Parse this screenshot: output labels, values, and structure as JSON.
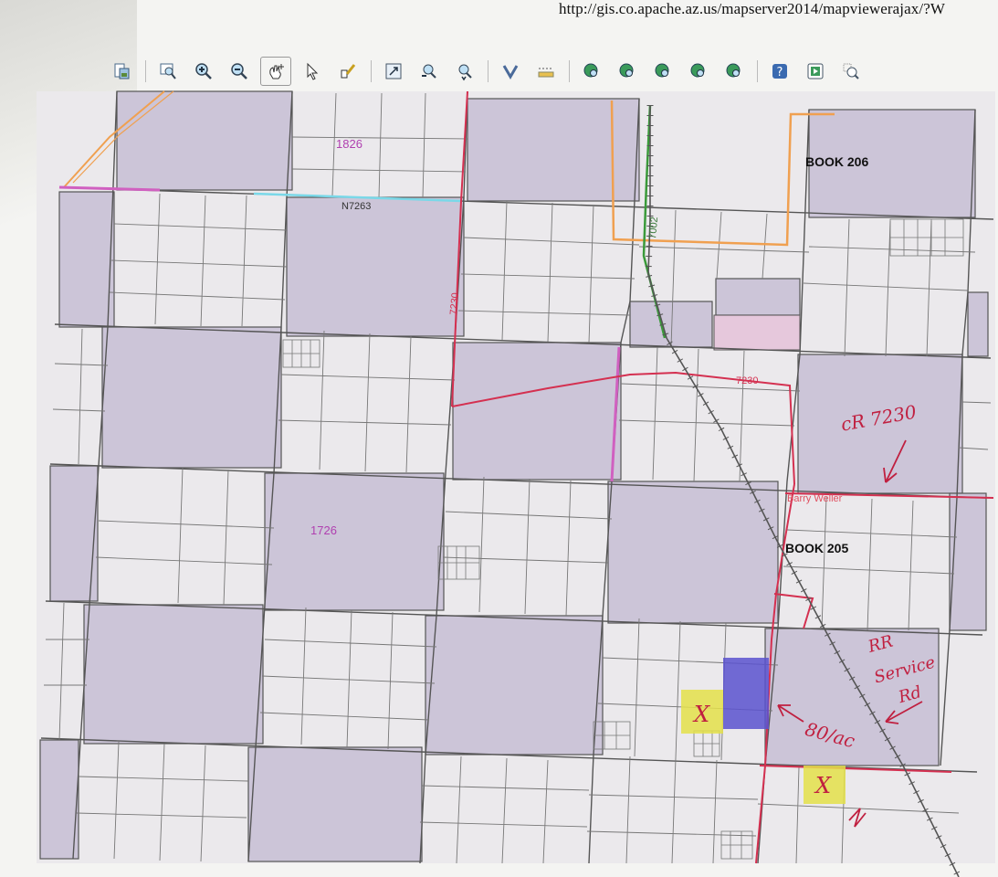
{
  "browser": {
    "url": "http://gis.co.apache.az.us/mapserver2014/mapviewerajax/?W"
  },
  "toolbar": {
    "tools": [
      "layers-icon",
      "zoom-box-icon",
      "zoom-in-icon",
      "zoom-out-icon",
      "pan-icon",
      "select-arrow-icon",
      "identify-pencil-icon",
      "full-extent-icon",
      "zoom-back-icon",
      "zoom-forward-icon",
      "measure-icon",
      "ruler-icon",
      "globe-1-icon",
      "globe-2-icon",
      "globe-3-icon",
      "globe-4-icon",
      "globe-5-icon",
      "help-icon",
      "print-icon",
      "search-zoom-icon"
    ]
  },
  "map": {
    "labels": {
      "parcel_1826": "1826",
      "road_n7263": "N7263",
      "book_206": "BOOK 206",
      "road_7230_vertical": "7230",
      "road_7002": "7002",
      "road_7230_horizontal": "7230",
      "parcel_1726": "1726",
      "book_205": "BOOK 205",
      "road_barry_weller": "Barry Weller"
    },
    "annotations": {
      "cr_7230": "cR 7230",
      "rr_service_rd_1": "RR",
      "rr_service_rd_2": "Service",
      "rr_service_rd_3": "Rd",
      "acreage": "80/ac",
      "mark_x_1": "X",
      "mark_x_2": "X"
    },
    "colors": {
      "parcel_fill": "#ebe9ec",
      "purple_parcel": "#ccc5d8",
      "pink_parcel": "#e6c8dc",
      "highlight_yellow": "#e4e04a",
      "highlight_blue": "#5a52cf",
      "red_line": "#d43050",
      "orange_line": "#f0a050",
      "green_line": "#3a9a3a",
      "railroad": "#555555",
      "label_purple": "#b040b0"
    }
  }
}
